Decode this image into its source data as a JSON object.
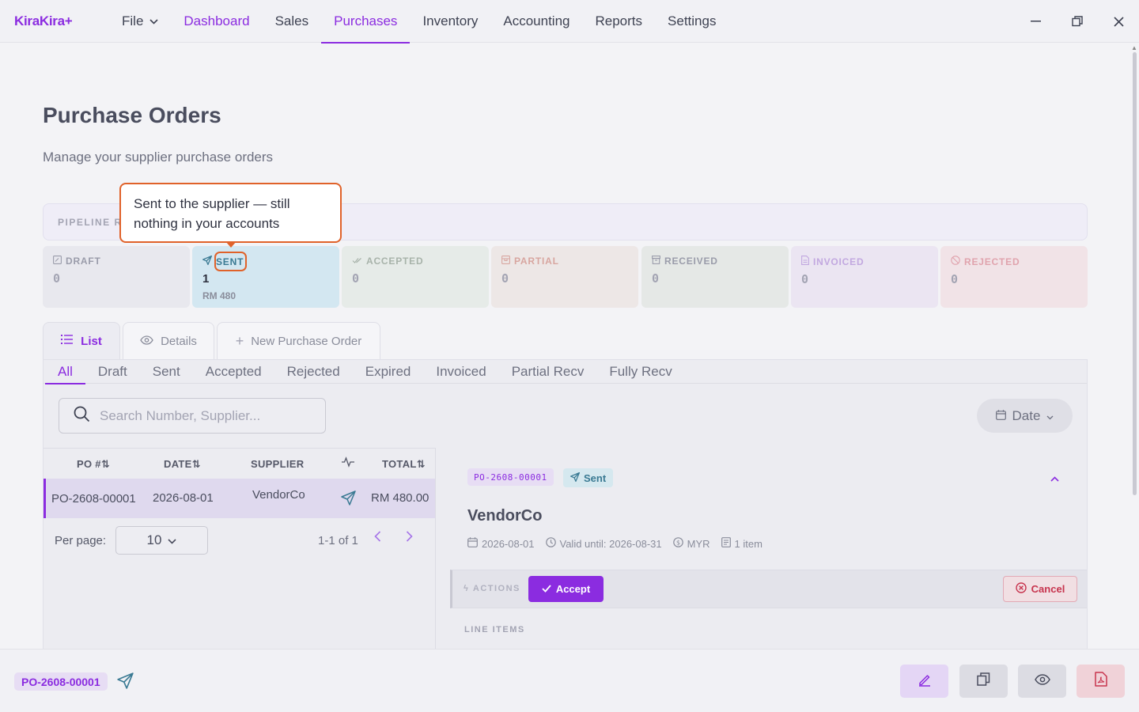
{
  "app": {
    "name": "KiraKira+"
  },
  "nav": {
    "file": "File",
    "items": [
      "Dashboard",
      "Sales",
      "Purchases",
      "Inventory",
      "Accounting",
      "Reports",
      "Settings"
    ],
    "active": "Purchases"
  },
  "page": {
    "title": "Purchase Orders",
    "subtitle": "Manage your supplier purchase orders"
  },
  "pipeline": {
    "label": "PIPELINE R",
    "stages": [
      {
        "key": "draft",
        "label": "DRAFT",
        "count": "0",
        "amount": "",
        "icon": "edit-doc-icon",
        "color": "#9a9caa",
        "bg": "#e8e8ee"
      },
      {
        "key": "sent",
        "label": "SENT",
        "count": "1",
        "amount": "RM 480",
        "icon": "send-icon",
        "color": "#3a7a93",
        "bg": "#d3e7f1"
      },
      {
        "key": "accepted",
        "label": "ACCEPTED",
        "count": "0",
        "amount": "",
        "icon": "check-double-icon",
        "color": "#a8b3aa",
        "bg": "#e6ebe8"
      },
      {
        "key": "partial",
        "label": "PARTIAL",
        "count": "0",
        "amount": "",
        "icon": "box-icon",
        "color": "#d8a6a0",
        "bg": "#ede7e6"
      },
      {
        "key": "received",
        "label": "RECEIVED",
        "count": "0",
        "amount": "",
        "icon": "archive-icon",
        "color": "#9a9caa",
        "bg": "#e5e8e6"
      },
      {
        "key": "invoiced",
        "label": "INVOICED",
        "count": "0",
        "amount": "",
        "icon": "file-icon",
        "color": "#c2a8e0",
        "bg": "#ebe5f2"
      },
      {
        "key": "rejected",
        "label": "REJECTED",
        "count": "0",
        "amount": "",
        "icon": "ban-icon",
        "color": "#e0a3ad",
        "bg": "#f1e3e7"
      }
    ]
  },
  "tooltip": {
    "line1": "Sent to the supplier — still",
    "line2": "nothing in your accounts"
  },
  "view_tabs": {
    "list": "List",
    "details": "Details",
    "new": "New Purchase Order"
  },
  "filter_tabs": [
    "All",
    "Draft",
    "Sent",
    "Accepted",
    "Rejected",
    "Expired",
    "Invoiced",
    "Partial Recv",
    "Fully Recv"
  ],
  "search": {
    "placeholder": "Search Number, Supplier..."
  },
  "date_filter": "Date",
  "table": {
    "headers": {
      "po": "PO #",
      "date": "DATE",
      "supplier": "SUPPLIER",
      "total": "TOTAL"
    },
    "rows": [
      {
        "po": "PO-2608-00001",
        "date": "2026-08-01",
        "supplier": "VendorCo",
        "total": "RM 480.00"
      }
    ]
  },
  "pagination": {
    "per_page_label": "Per page:",
    "per_page_value": "10",
    "range": "1-1 of 1"
  },
  "detail": {
    "po_number": "PO-2608-00001",
    "status": "Sent",
    "vendor": "VendorCo",
    "date": "2026-08-01",
    "valid_until": "Valid until: 2026-08-31",
    "currency": "MYR",
    "items": "1 item",
    "actions_label": "ACTIONS",
    "accept": "Accept",
    "cancel": "Cancel",
    "line_items_label": "LINE ITEMS"
  },
  "bottombar": {
    "po_number": "PO-2608-00001"
  },
  "colors": {
    "accent": "#8b2ce0",
    "sent": "#3a7a93",
    "danger": "#c7344e",
    "callout": "#e0622a"
  }
}
